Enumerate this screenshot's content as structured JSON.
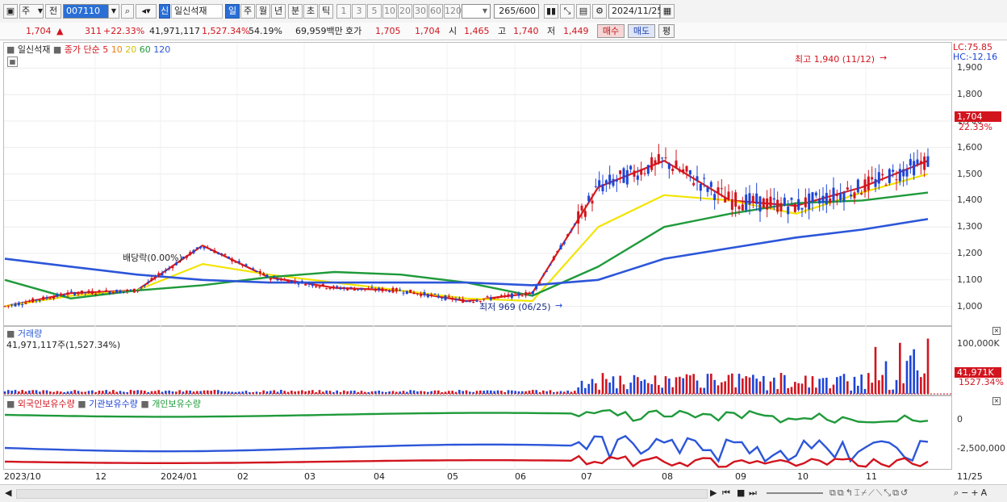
{
  "toolbar": {
    "market_select": "주",
    "prev_label": "전",
    "code": "007110",
    "badge": "신",
    "name": "일신석재",
    "periods": [
      "일",
      "주",
      "월",
      "년",
      "분",
      "초",
      "틱"
    ],
    "active_period": "일",
    "intervals": [
      "1",
      "3",
      "5",
      "10",
      "20",
      "30",
      "60",
      "120"
    ],
    "count": "265",
    "count_total": "/600",
    "date": "2024/11/25"
  },
  "quote": {
    "price": "1,704",
    "change": "311",
    "change_pct": "+22.33%",
    "volume": "41,971,117",
    "volume_pct": "1,527.34%",
    "ratio": "54.19%",
    "amount": "69,959백만",
    "ask_label": "호가",
    "ask1": "1,705",
    "ask2": "1,704",
    "open_label": "시",
    "open": "1,465",
    "high_label": "고",
    "high": "1,740",
    "low_label": "저",
    "low": "1,449",
    "buy_label": "매수",
    "sell_label": "매도",
    "flat_label": "평"
  },
  "price_panel": {
    "name": "일신석재",
    "ma_label": "종가 단순",
    "ma_periods": [
      "5",
      "10",
      "20",
      "60",
      "120"
    ],
    "lc": "LC:75.85",
    "hc": "HC:-12.16",
    "high_note": "최고 1,940 (11/12)",
    "low_note": "최저 969 (06/25)",
    "dividend_note": "배당락(0.00%)",
    "cur_price": "1,704",
    "cur_pct": "22.33%",
    "yticks": [
      "1,900",
      "1,800",
      "1,700",
      "1,600",
      "1,500",
      "1,400",
      "1,300",
      "1,200",
      "1,100",
      "1,000"
    ]
  },
  "volume_panel": {
    "title": "거래량",
    "value": "41,971,117주(1,527.34%)",
    "ytick": "100,000K",
    "cur": "41,971K",
    "cur_pct": "1527.34%"
  },
  "holdings_panel": {
    "series": [
      "외국인보유수량",
      "기관보유수량",
      "개인보유수량"
    ],
    "yticks": [
      "0",
      "-2,500,000"
    ]
  },
  "xaxis": {
    "labels": [
      "2023/10",
      "12",
      "2024/01",
      "02",
      "03",
      "04",
      "05",
      "06",
      "07",
      "08",
      "09",
      "10",
      "11",
      "11/25"
    ]
  },
  "colors": {
    "up": "#d2141e",
    "down": "#1d45d8",
    "ma5": "#d91b1b",
    "ma10": "#f07f10",
    "ma20": "#f2e400",
    "ma60": "#1f9a3a",
    "ma120": "#2c56d9"
  },
  "chart_data": {
    "type": "line",
    "title": "일신석재",
    "x": [
      "2023/10",
      "12",
      "2024/01",
      "02",
      "03",
      "04",
      "05",
      "06",
      "07",
      "08",
      "09",
      "10",
      "11",
      "11/25"
    ],
    "series": [
      {
        "name": "5",
        "values": [
          1000,
          1050,
          1060,
          1230,
          1110,
          1070,
          1060,
          1020,
          1050,
          1450,
          1550,
          1400,
          1380,
          1450,
          1550
        ]
      },
      {
        "name": "20",
        "values": [
          1000,
          1040,
          1060,
          1160,
          1120,
          1090,
          1060,
          1030,
          1020,
          1300,
          1420,
          1400,
          1350,
          1430,
          1500
        ]
      },
      {
        "name": "60",
        "values": [
          1100,
          1030,
          1060,
          1080,
          1110,
          1130,
          1120,
          1090,
          1040,
          1150,
          1300,
          1350,
          1390,
          1400,
          1430
        ]
      },
      {
        "name": "120",
        "values": [
          1180,
          1150,
          1120,
          1100,
          1090,
          1090,
          1090,
          1090,
          1080,
          1100,
          1180,
          1220,
          1260,
          1290,
          1330
        ]
      }
    ],
    "ylim": [
      950,
      1950
    ]
  }
}
